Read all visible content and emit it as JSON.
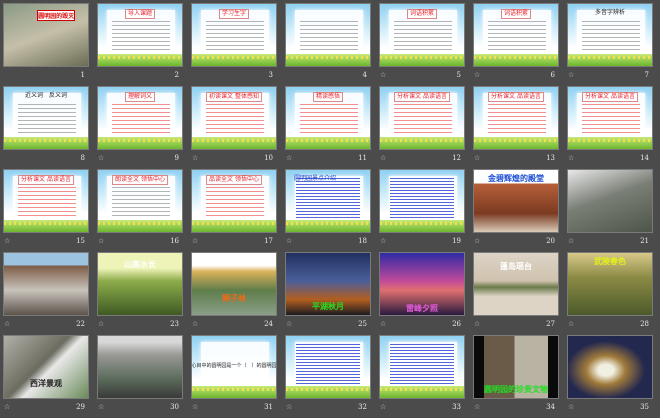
{
  "view": "slide-sorter",
  "star_glyph": "☆",
  "slides": [
    {
      "number": "1",
      "kind": "photo",
      "title": "圆明园的毁灭",
      "bg": "linear-gradient(160deg,#8a9a86,#c5bfa8 50%,#6b6d55)",
      "cap_color": "#d11",
      "star": false
    },
    {
      "number": "2",
      "kind": "tpl",
      "title": "导入课题",
      "lines": "gray",
      "star": false
    },
    {
      "number": "3",
      "kind": "tpl",
      "title": "学习生字",
      "lines": "gray",
      "star": false
    },
    {
      "number": "4",
      "kind": "tpl",
      "title": "",
      "lines": "gray",
      "star": false
    },
    {
      "number": "5",
      "kind": "tpl",
      "title": "词语积累",
      "lines": "gray",
      "star": true
    },
    {
      "number": "6",
      "kind": "tpl",
      "title": "词语积累",
      "lines": "gray",
      "star": true
    },
    {
      "number": "7",
      "kind": "tpl",
      "title": "多音字辨析",
      "plain": true,
      "lines": "gray",
      "star": true
    },
    {
      "number": "8",
      "kind": "tpl",
      "title": "近义词　反义词",
      "plain": true,
      "lines": "gray",
      "star": false
    },
    {
      "number": "9",
      "kind": "tpl",
      "title": "理解词义",
      "lines": "red",
      "star": true
    },
    {
      "number": "10",
      "kind": "tpl",
      "title": "初读课文 整体感知",
      "lines": "red",
      "star": true
    },
    {
      "number": "11",
      "kind": "tpl",
      "title": "精读感悟",
      "lines": "red",
      "star": true
    },
    {
      "number": "12",
      "kind": "tpl",
      "title": "分析课文 品读语言",
      "lines": "red",
      "star": true
    },
    {
      "number": "13",
      "kind": "tpl",
      "title": "分析课文 品读语言",
      "lines": "red",
      "star": true
    },
    {
      "number": "14",
      "kind": "tpl",
      "title": "分析课文 品读语言",
      "lines": "red",
      "star": true
    },
    {
      "number": "15",
      "kind": "tpl",
      "title": "分析课文 品读语言",
      "lines": "red",
      "star": true
    },
    {
      "number": "16",
      "kind": "tpl",
      "title": "朗读全文 领悟中心",
      "lines": "gray",
      "star": true
    },
    {
      "number": "17",
      "kind": "tpl",
      "title": "品读全文 领悟中心",
      "lines": "red",
      "star": true
    },
    {
      "number": "18",
      "kind": "tpl",
      "title": "圆明园景点介绍",
      "blue": true,
      "lines": "blue",
      "star": true
    },
    {
      "number": "19",
      "kind": "tpl",
      "title": "",
      "lines": "blue",
      "star": true
    },
    {
      "number": "20",
      "kind": "photo",
      "title": "金碧辉煌的殿堂",
      "bg": "linear-gradient(180deg,#fff 0 22%,#b8603a 22%,#7a3a20 70%,#d9cbb8)",
      "cap_color": "#1d4fd6",
      "star": true
    },
    {
      "number": "21",
      "kind": "photo",
      "title": "",
      "bg": "linear-gradient(160deg,#e8e8e8,#7a7f76 45%,#4d5448)",
      "star": true
    },
    {
      "number": "22",
      "kind": "photo",
      "title": "",
      "bg": "linear-gradient(180deg,#9cc3e0 0 20%,#7c5a44 20%,#c8c3bb 60%,#5d544c)",
      "star": true
    },
    {
      "number": "23",
      "kind": "photo",
      "title": "山高水长",
      "bg": "linear-gradient(180deg,#eef3b8 0 25%,#8cac4a 45%,#3e5a24)",
      "cap_color": "#fff",
      "star": true
    },
    {
      "number": "24",
      "kind": "photo",
      "title": "狮子林",
      "bg": "linear-gradient(180deg,#fff 0 20%,#d9b25a 30%,#5f7d4a 60%,#8a9f8a)",
      "cap_color": "#f26a12",
      "star": true
    },
    {
      "number": "25",
      "kind": "photo",
      "title": "平湖秋月",
      "bg": "linear-gradient(180deg,#22305f,#4a5f9a 45%,#b35e1f 75%,#1c1c22)",
      "cap_color": "#22e022",
      "star": true
    },
    {
      "number": "26",
      "kind": "photo",
      "title": "雷峰夕照",
      "bg": "linear-gradient(180deg,#2e2aa4,#c04a9a 45%,#e07070 60%,#2a1a40)",
      "cap_color": "#e05ad8",
      "star": true
    },
    {
      "number": "27",
      "kind": "photo",
      "title": "蓬岛瑶台",
      "bg": "linear-gradient(180deg,#ddd4c6,#cfc2ae 45%,#6a7a4a 55%,#ddd4c6 70%)",
      "cap_color": "#fff",
      "star": true
    },
    {
      "number": "28",
      "kind": "photo",
      "title": "武陵春色",
      "bg": "linear-gradient(180deg,#d8c88a,#8a8a44 40%,#4c5a2a)",
      "cap_color": "#e4f01a",
      "star": true
    },
    {
      "number": "29",
      "kind": "photo",
      "title": "西洋景观",
      "bg": "linear-gradient(135deg,#b0b0a8,#6c6c60 45%,#e8e8e8 55%,#6a8a5a)",
      "cap_color": "#222",
      "star": true
    },
    {
      "number": "30",
      "kind": "photo",
      "title": "",
      "bg": "linear-gradient(180deg,#d8d8d8 0 10%,#9a9a96 30%,#5a6a5a 70%,#3a3a3a)",
      "star": true
    },
    {
      "number": "31",
      "kind": "tpl",
      "title": "我心目中的圆明园是一个（　）的圆明园。",
      "plain": true,
      "lines": "none",
      "star": true
    },
    {
      "number": "32",
      "kind": "tpl",
      "title": "",
      "lines": "blue",
      "star": true
    },
    {
      "number": "33",
      "kind": "tpl",
      "title": "",
      "lines": "blue",
      "star": true
    },
    {
      "number": "34",
      "kind": "photo",
      "title": "圆明园的珍贵文物",
      "bg": "linear-gradient(90deg,#0a0a0a 0 12%,#6a5a48 12% 48%,#b9b3a3 48% 88%,#0a0a0a 88%)",
      "cap_color": "#22e022",
      "star": true
    },
    {
      "number": "35",
      "kind": "photo",
      "title": "",
      "bg": "radial-gradient(ellipse at 45% 55%,#f0efe0 0 12%,#a07a3a 30%,#23284f 60%)",
      "star": true
    }
  ]
}
